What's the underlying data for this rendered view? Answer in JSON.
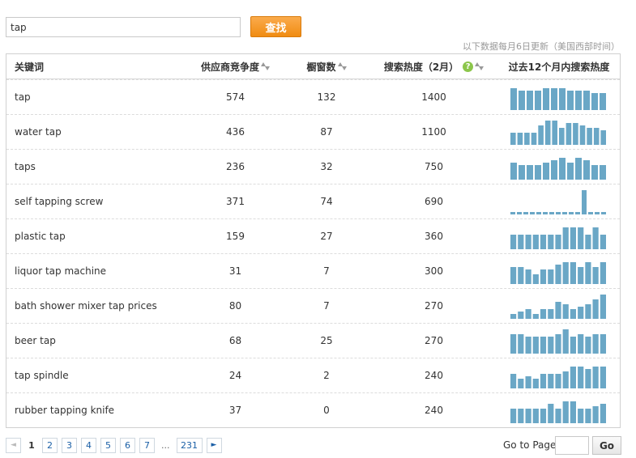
{
  "search": {
    "value": "tap",
    "button_label": "查找"
  },
  "update_note": "以下数据每月6日更新（美国西部时间）",
  "table": {
    "headers": {
      "keyword": "关键词",
      "supplier": "供应商竞争度",
      "window": "橱窗数",
      "hotness": "搜索热度（2月）",
      "trend": "过去12个月内搜索热度"
    },
    "rows": [
      {
        "keyword": "tap",
        "supplier": "574",
        "window": "132",
        "hotness": "1400",
        "trend": [
          9,
          8,
          8,
          8,
          9,
          9,
          9,
          8,
          8,
          8,
          7,
          7
        ]
      },
      {
        "keyword": "water tap",
        "supplier": "436",
        "window": "87",
        "hotness": "1100",
        "trend": [
          5,
          5,
          5,
          5,
          8,
          10,
          10,
          7,
          9,
          9,
          8,
          7,
          7,
          6
        ]
      },
      {
        "keyword": "taps",
        "supplier": "236",
        "window": "32",
        "hotness": "750",
        "trend": [
          7,
          6,
          6,
          6,
          7,
          8,
          9,
          7,
          9,
          8,
          6,
          6
        ]
      },
      {
        "keyword": "self tapping screw",
        "supplier": "371",
        "window": "74",
        "hotness": "690",
        "trend": [
          1,
          1,
          1,
          1,
          1,
          1,
          1,
          1,
          1,
          1,
          1,
          10,
          1,
          1,
          1
        ]
      },
      {
        "keyword": "plastic tap",
        "supplier": "159",
        "window": "27",
        "hotness": "360",
        "trend": [
          6,
          6,
          6,
          6,
          6,
          6,
          6,
          9,
          9,
          9,
          6,
          9,
          6
        ]
      },
      {
        "keyword": "liquor tap machine",
        "supplier": "31",
        "window": "7",
        "hotness": "300",
        "trend": [
          7,
          7,
          6,
          4,
          6,
          6,
          8,
          9,
          9,
          7,
          9,
          7,
          9
        ]
      },
      {
        "keyword": "bath shower mixer tap prices",
        "supplier": "80",
        "window": "7",
        "hotness": "270",
        "trend": [
          2,
          3,
          4,
          2,
          4,
          4,
          7,
          6,
          4,
          5,
          6,
          8,
          10
        ]
      },
      {
        "keyword": "beer tap",
        "supplier": "68",
        "window": "25",
        "hotness": "270",
        "trend": [
          8,
          8,
          7,
          7,
          7,
          7,
          8,
          10,
          7,
          8,
          7,
          8,
          8
        ]
      },
      {
        "keyword": "tap spindle",
        "supplier": "24",
        "window": "2",
        "hotness": "240",
        "trend": [
          6,
          4,
          5,
          4,
          6,
          6,
          6,
          7,
          9,
          9,
          8,
          9,
          9
        ]
      },
      {
        "keyword": "rubber tapping knife",
        "supplier": "37",
        "window": "0",
        "hotness": "240",
        "trend": [
          6,
          6,
          6,
          6,
          6,
          8,
          6,
          9,
          9,
          6,
          6,
          7,
          8
        ]
      }
    ]
  },
  "pagination": {
    "current": "1",
    "pages": [
      "2",
      "3",
      "4",
      "5",
      "6",
      "7"
    ],
    "ellipsis": "...",
    "last": "231",
    "prev": "◄",
    "next": "►"
  },
  "goto": {
    "label": "Go to Page",
    "value": "",
    "button_label": "Go"
  },
  "colors": {
    "bar": "#6aa7c6",
    "accent": "#f08c12",
    "link": "#1a5fa6"
  }
}
